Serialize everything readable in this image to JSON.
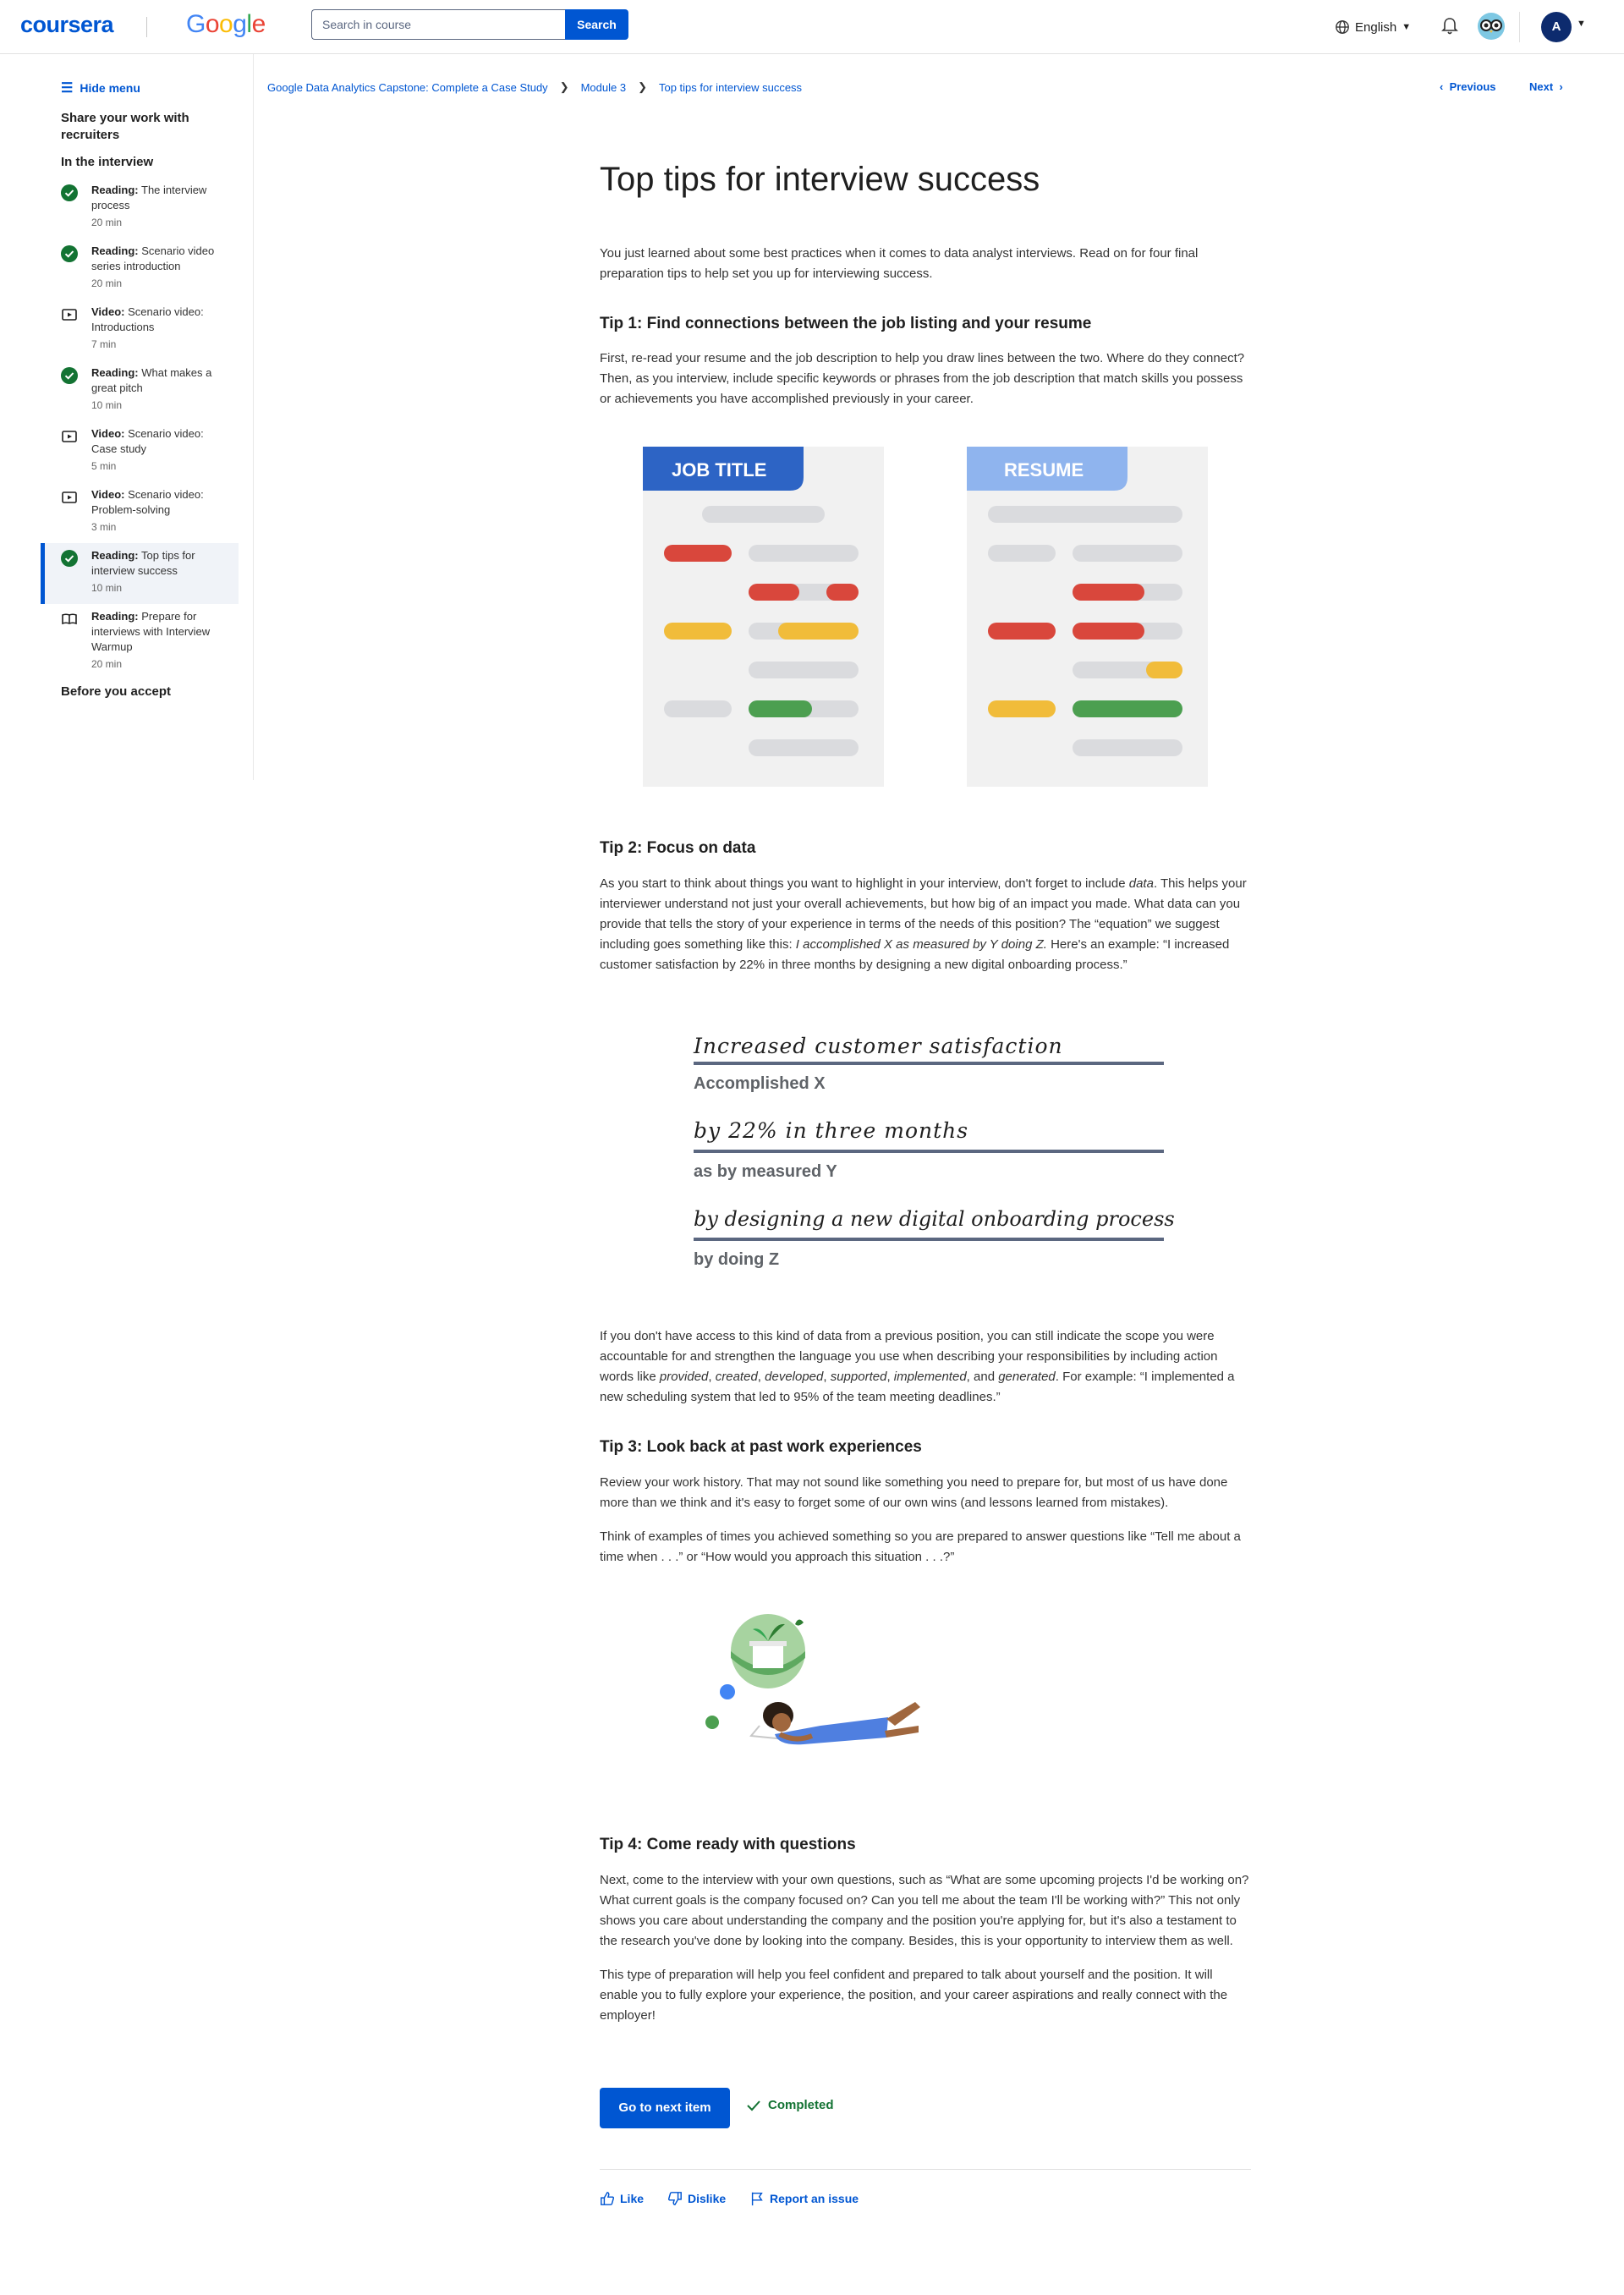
{
  "header": {
    "logo_coursera": "coursera",
    "logo_google": "Google",
    "search_placeholder": "Search in course",
    "search_button": "Search",
    "language": "English",
    "avatar_initial": "A"
  },
  "sidebar": {
    "hide_menu": "Hide menu",
    "section_title": "Share your work with recruiters",
    "subsection": "In the interview",
    "items": [
      {
        "type": "Reading:",
        "title": "The interview process",
        "duration": "20 min",
        "status": "completed"
      },
      {
        "type": "Reading:",
        "title": "Scenario video series introduction",
        "duration": "20 min",
        "status": "completed"
      },
      {
        "type": "Video:",
        "title": "Scenario video: Introductions",
        "duration": "7 min",
        "status": "video"
      },
      {
        "type": "Reading:",
        "title": "What makes a great pitch",
        "duration": "10 min",
        "status": "completed"
      },
      {
        "type": "Video:",
        "title": "Scenario video: Case study",
        "duration": "5 min",
        "status": "video"
      },
      {
        "type": "Video:",
        "title": "Scenario video: Problem-solving",
        "duration": "3 min",
        "status": "video"
      },
      {
        "type": "Reading:",
        "title": "Top tips for interview success",
        "duration": "10 min",
        "status": "completed"
      },
      {
        "type": "Reading:",
        "title": "Prepare for interviews with Interview Warmup",
        "duration": "20 min",
        "status": "book"
      }
    ],
    "next_section": "Before you accept"
  },
  "breadcrumb": {
    "course": "Google Data Analytics Capstone: Complete a Case Study",
    "module": "Module 3",
    "page": "Top tips for interview success",
    "previous": "Previous",
    "next": "Next"
  },
  "content": {
    "title": "Top tips for interview success",
    "intro": "You just learned about some best practices when it comes to data analyst interviews. Read on for four final preparation tips to help set you up for interviewing success.",
    "tip1_heading": "Tip 1: Find connections between the job listing and your resume",
    "tip1_body": "First, re-read your resume and the job description to help you draw lines between the two. Where do they connect? Then, as you interview, include specific keywords or phrases from the job description that match skills you possess or achievements you have accomplished previously in your career.",
    "img1_left_label": "JOB TITLE",
    "img1_right_label": "RESUME",
    "tip2_heading": "Tip 2: Focus on data",
    "tip2_body_a": "As you start to think about things you want to highlight in your interview, don't forget to include ",
    "tip2_body_em1": "data",
    "tip2_body_b": ". This helps your interviewer understand not just your overall achievements, but how big of an impact you made. What data can you provide that tells the story of your experience in terms of the needs of this position? The “equation” we suggest including goes something like this: ",
    "tip2_body_em2": "I accomplished X as measured by Y doing Z.",
    "tip2_body_c": " Here's an example: “I increased customer satisfaction by 22% in three months by designing a new digital onboarding process.”",
    "img2_line1": "Increased customer satisfaction",
    "img2_label1": "Accomplished X",
    "img2_line2": "by 22% in three months",
    "img2_label2": "as by measured Y",
    "img2_line3": "by designing a new digital onboarding process",
    "img2_label3": "by doing Z",
    "tip2_after_a": "If you don't have access to this kind of data from a previous position, you can still indicate the scope you were accountable for and strengthen the language you use when describing your responsibilities by including action words like ",
    "tip2_after_words": [
      "provided",
      "created",
      "developed",
      "supported",
      "implemented",
      "generated"
    ],
    "tip2_after_c": ". For example: “I implemented a new scheduling system that led to 95% of the team meeting deadlines.”",
    "tip3_heading": "Tip 3: Look back at past work experiences",
    "tip3_body1": "Review your work history. That may not sound like something you need to prepare for, but most of us have done more than we think and it's easy to forget some of our own wins (and lessons learned from mistakes).",
    "tip3_body2": "Think of examples of times you achieved something so you are prepared to answer questions  like “Tell me about a time when . . .” or “How would you approach this situation . . .?”",
    "tip4_heading": "Tip 4: Come ready with questions",
    "tip4_body1": "Next, come to the interview with your own questions, such as “What are some upcoming projects I'd be working on? What current goals is the company focused on? Can you tell me about the team I'll be working with?” This not only shows you care about understanding the company and the position you're applying for, but it's also a testament to the research you've done by looking into the company. Besides, this is your opportunity to interview them as well.",
    "tip4_body2": "This type of preparation will help you feel confident and prepared to talk about yourself and the position. It will enable you to fully explore your experience, the position, and your career aspirations and really connect with the employer!"
  },
  "footer": {
    "next_button": "Go to next item",
    "completed": "Completed",
    "like": "Like",
    "dislike": "Dislike",
    "report": "Report an issue"
  },
  "colors": {
    "brand_blue": "#0056d2",
    "complete_green": "#137333",
    "red": "#d9473c",
    "yellow": "#f1bc3a",
    "green": "#4c9f50",
    "gray": "#dadbde"
  }
}
